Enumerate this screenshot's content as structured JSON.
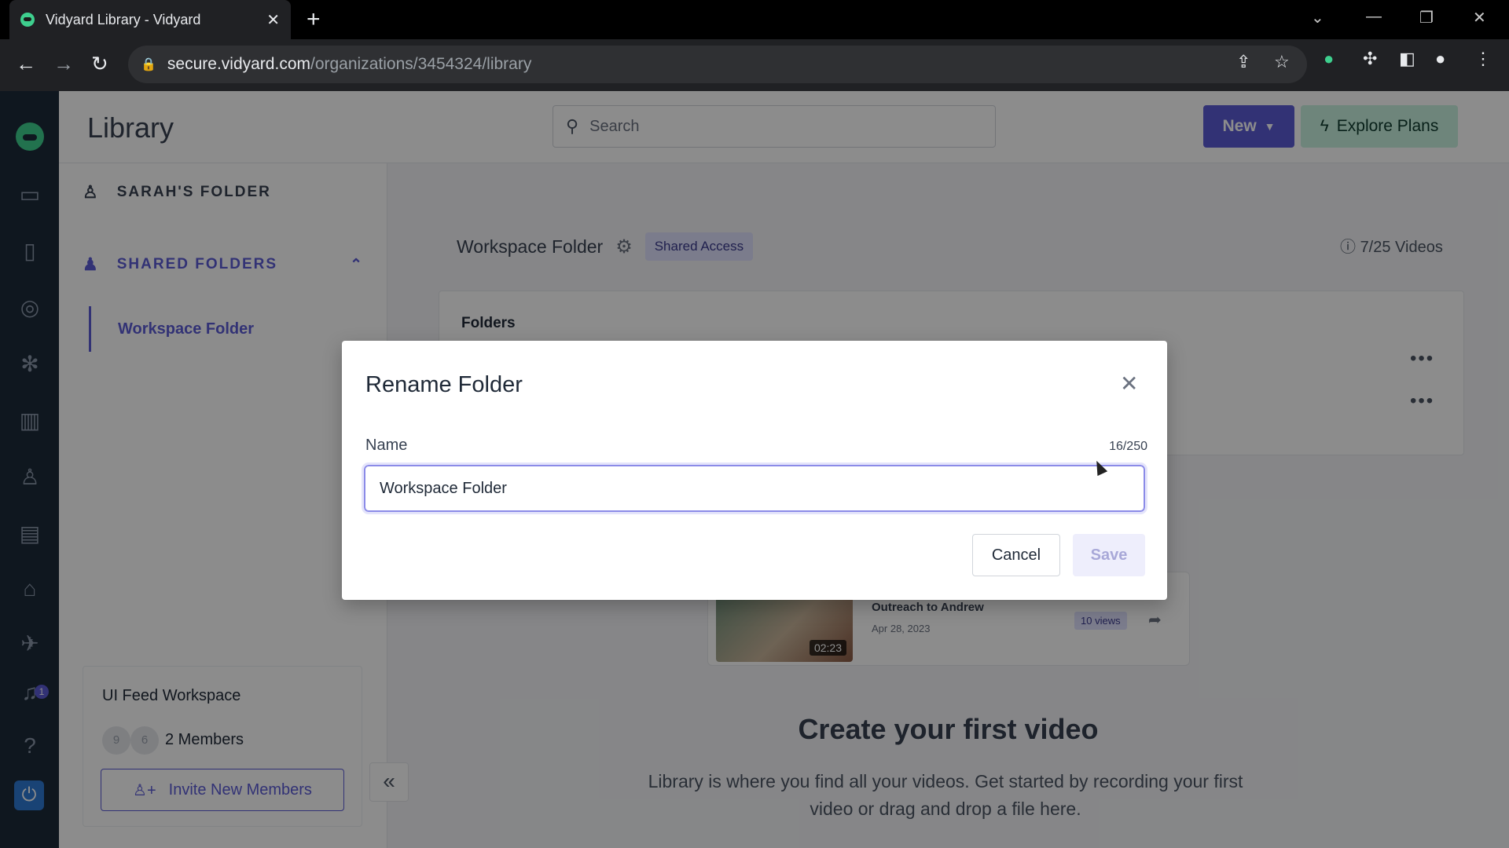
{
  "browser": {
    "tab_title": "Vidyard Library - Vidyard",
    "url_host": "secure.vidyard.com",
    "url_path": "/organizations/3454324/library",
    "extension_badge": "1"
  },
  "header": {
    "title": "Library",
    "search_placeholder": "Search",
    "new_label": "New",
    "explore_label": "Explore Plans"
  },
  "sidebar": {
    "personal_folder": "SARAH'S FOLDER",
    "shared_folders": "SHARED FOLDERS",
    "active_folder": "Workspace Folder",
    "workspace": {
      "name": "UI Feed Workspace",
      "avatars": [
        "9",
        "6"
      ],
      "members": "2 Members",
      "invite_label": "Invite New Members"
    },
    "notification_count": "1"
  },
  "main": {
    "folder_name": "Workspace Folder",
    "access_badge": "Shared Access",
    "video_count": "7/25 Videos",
    "folders_title": "Folders",
    "sample_video": {
      "title": "Outreach to Andrew",
      "date": "Apr 28, 2023",
      "duration": "02:23",
      "views": "10 views"
    },
    "empty_title": "Create your first video",
    "empty_description": "Library is where you find all your videos. Get started by recording your first video or drag and drop a file here."
  },
  "modal": {
    "title": "Rename Folder",
    "field_label": "Name",
    "char_count": "16/250",
    "input_value": "Workspace Folder",
    "cancel_label": "Cancel",
    "save_label": "Save"
  },
  "colors": {
    "accent": "#5b5bd6",
    "rail": "#1c2a3a",
    "explore": "#c9f2e0"
  }
}
